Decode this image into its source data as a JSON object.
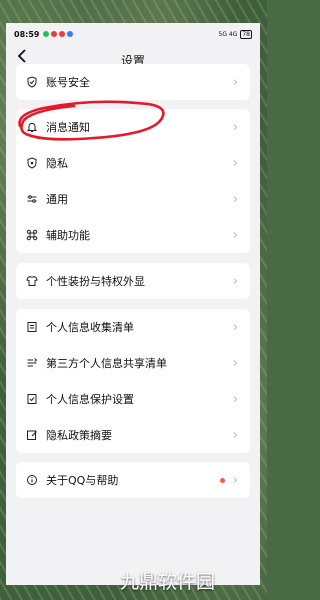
{
  "status_bar": {
    "time": "08:59",
    "right_indicators": "5G 4G",
    "battery": "78"
  },
  "header": {
    "back_icon": "chevron-left-icon",
    "title": "设置"
  },
  "groups": [
    {
      "items": [
        {
          "label": "账号安全",
          "icon": "shield-check-icon"
        }
      ]
    },
    {
      "items": [
        {
          "label": "消息通知",
          "icon": "bell-icon"
        },
        {
          "label": "隐私",
          "icon": "shield-icon"
        },
        {
          "label": "通用",
          "icon": "sliders-icon"
        },
        {
          "label": "辅助功能",
          "icon": "command-icon"
        }
      ]
    },
    {
      "items": [
        {
          "label": "个性装扮与特权外显",
          "icon": "shirt-icon"
        }
      ]
    },
    {
      "items": [
        {
          "label": "个人信息收集清单",
          "icon": "document-icon"
        },
        {
          "label": "第三方个人信息共享清单",
          "icon": "share-list-icon"
        },
        {
          "label": "个人信息保护设置",
          "icon": "check-file-icon"
        },
        {
          "label": "隐私政策摘要",
          "icon": "edit-icon"
        }
      ]
    },
    {
      "items": [
        {
          "label": "关于QQ与帮助",
          "icon": "info-icon",
          "badge": "red-dot"
        }
      ]
    }
  ],
  "watermark": "九鼎软件园",
  "colors": {
    "annotation": "#e8182a",
    "badge": "#ff5a3c",
    "background": "#f2f2f4"
  }
}
